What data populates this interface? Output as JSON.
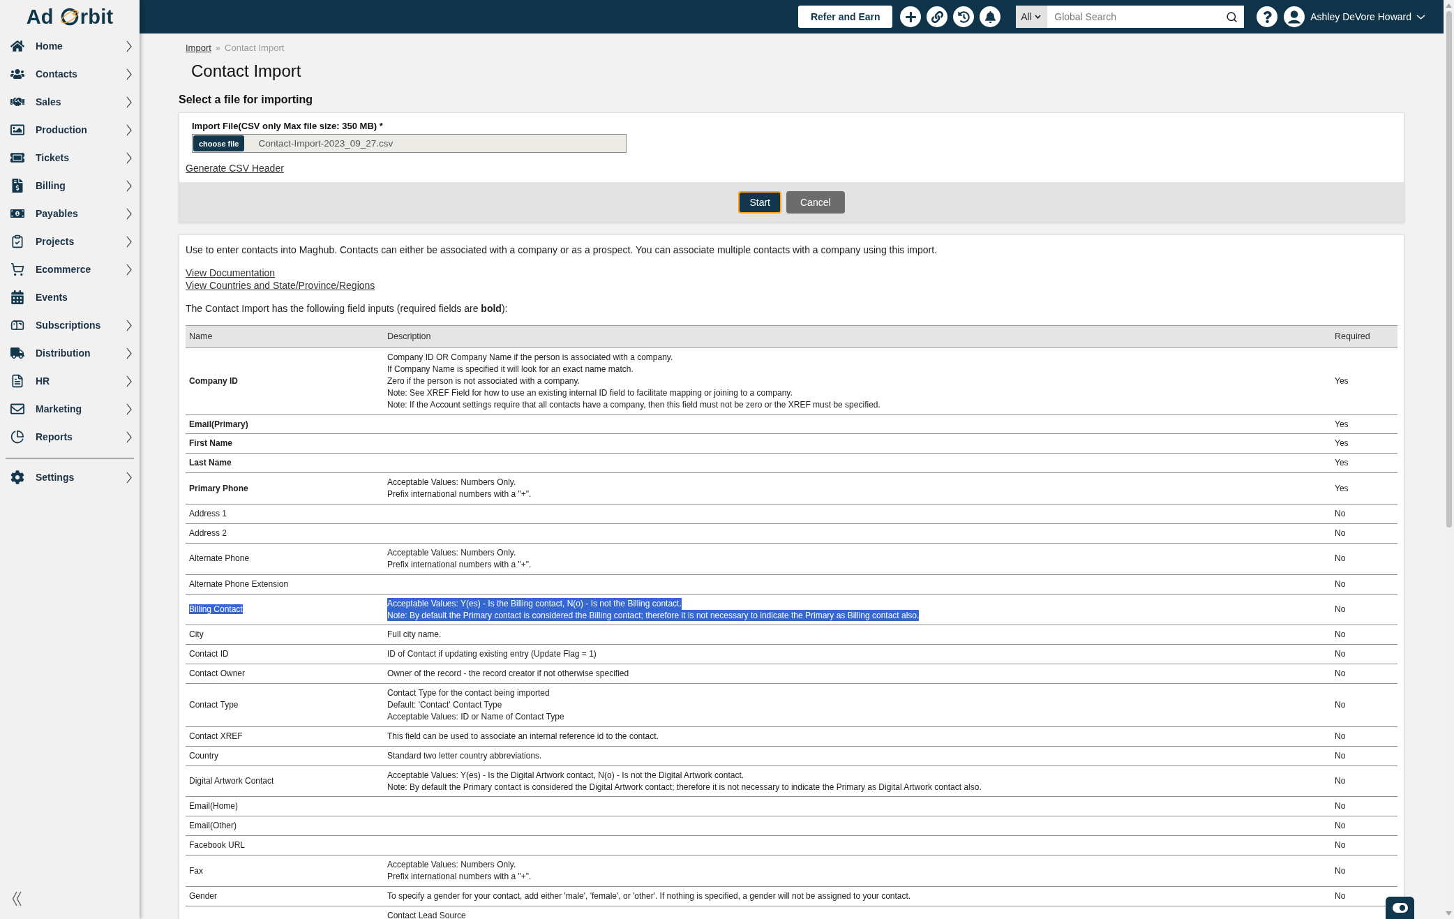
{
  "sidebar": {
    "logo": {
      "left": "Ad",
      "right": "rbit"
    },
    "items": [
      {
        "label": "Home",
        "has_submenu": true
      },
      {
        "label": "Contacts",
        "has_submenu": true
      },
      {
        "label": "Sales",
        "has_submenu": true
      },
      {
        "label": "Production",
        "has_submenu": true
      },
      {
        "label": "Tickets",
        "has_submenu": true
      },
      {
        "label": "Billing",
        "has_submenu": true
      },
      {
        "label": "Payables",
        "has_submenu": true
      },
      {
        "label": "Projects",
        "has_submenu": true
      },
      {
        "label": "Ecommerce",
        "has_submenu": true
      },
      {
        "label": "Events",
        "has_submenu": false
      },
      {
        "label": "Subscriptions",
        "has_submenu": true
      },
      {
        "label": "Distribution",
        "has_submenu": true
      },
      {
        "label": "HR",
        "has_submenu": true
      },
      {
        "label": "Marketing",
        "has_submenu": true
      },
      {
        "label": "Reports",
        "has_submenu": true
      }
    ],
    "bottom_items": [
      {
        "label": "Settings",
        "has_submenu": true
      }
    ]
  },
  "top_bar": {
    "refer_button": "Refer and Earn",
    "search": {
      "scope": "All",
      "placeholder": "Global Search"
    },
    "user_name": "Ashley DeVore Howard"
  },
  "breadcrumb": {
    "separator": "»",
    "items": [
      {
        "label": "Import",
        "link": true
      },
      {
        "label": "Contact Import",
        "link": false
      }
    ]
  },
  "title": "Contact Import",
  "upload": {
    "heading": "Select a file for importing",
    "field_label": "Import File(CSV only Max file size: 350 MB) *",
    "choose_button": "choose file",
    "file_name": "Contact-Import-2023_09_27.csv",
    "header_link": "Generate CSV Header",
    "buttons": [
      {
        "label": "Start",
        "kind": "primary",
        "focused": true
      },
      {
        "label": "Cancel",
        "kind": "secondary",
        "focused": false
      }
    ]
  },
  "info": {
    "intro": "Use to enter contacts into Maghub. Contacts can either be associated with a company or as a prospect. You can associate multiple contacts with a company using this import.",
    "links": [
      "View Documentation",
      "View Countries and State/Province/Regions"
    ],
    "note": "The Contact Import has the following field inputs (required fields are **bold**):"
  },
  "table": {
    "columns": [
      "Name",
      "Description",
      "Required"
    ],
    "rows": [
      {
        "name": "Company ID",
        "bold": true,
        "highlighted": false,
        "description": [
          "Company ID OR Company Name if the person is associated with a company.",
          "If Company Name is specified it will look for an exact name match.",
          "Zero if the person is not associated with a company.",
          "Note: See XREF Field for how to use an existing internal ID field to facilitate mapping or joining to a company.",
          "Note: If the Account settings require that all contacts have a company, then this field must not be zero or the XREF must be specified."
        ],
        "required": "Yes"
      },
      {
        "name": "Email(Primary)",
        "bold": true,
        "highlighted": false,
        "description": [],
        "required": "Yes"
      },
      {
        "name": "First Name",
        "bold": true,
        "highlighted": false,
        "description": [],
        "required": "Yes"
      },
      {
        "name": "Last Name",
        "bold": true,
        "highlighted": false,
        "description": [],
        "required": "Yes"
      },
      {
        "name": "Primary Phone",
        "bold": true,
        "highlighted": false,
        "description": [
          "Acceptable Values: Numbers Only.",
          "Prefix international numbers with a \"+\"."
        ],
        "required": "Yes"
      },
      {
        "name": "Address 1",
        "bold": false,
        "highlighted": false,
        "description": [],
        "required": "No"
      },
      {
        "name": "Address 2",
        "bold": false,
        "highlighted": false,
        "description": [],
        "required": "No"
      },
      {
        "name": "Alternate Phone",
        "bold": false,
        "highlighted": false,
        "description": [
          "Acceptable Values: Numbers Only.",
          "Prefix international numbers with a \"+\"."
        ],
        "required": "No"
      },
      {
        "name": "Alternate Phone Extension",
        "bold": false,
        "highlighted": false,
        "description": [],
        "required": "No"
      },
      {
        "name": "Billing Contact",
        "bold": false,
        "highlighted": true,
        "description": [
          "Acceptable Values: Y(es) - Is the Billing contact, N(o) - Is not the Billing contact.",
          "Note: By default the Primary contact is considered the Billing contact; therefore it is not necessary to indicate the Primary as Billing contact also."
        ],
        "required": "No"
      },
      {
        "name": "City",
        "bold": false,
        "highlighted": false,
        "description": [
          "Full city name."
        ],
        "required": "No"
      },
      {
        "name": "Contact ID",
        "bold": false,
        "highlighted": false,
        "description": [
          "ID of Contact if updating existing entry (Update Flag = 1)"
        ],
        "required": "No"
      },
      {
        "name": "Contact Owner",
        "bold": false,
        "highlighted": false,
        "description": [
          "Owner of the record - the record creator if not otherwise specified"
        ],
        "required": "No"
      },
      {
        "name": "Contact Type",
        "bold": false,
        "highlighted": false,
        "description": [
          "Contact Type for the contact being imported",
          "Default: 'Contact' Contact Type",
          "Acceptable Values: ID or Name of Contact Type"
        ],
        "required": "No"
      },
      {
        "name": "Contact XREF",
        "bold": false,
        "highlighted": false,
        "description": [
          "This field can be used to associate an internal reference id to the contact."
        ],
        "required": "No"
      },
      {
        "name": "Country",
        "bold": false,
        "highlighted": false,
        "description": [
          "Standard two letter country abbreviations."
        ],
        "required": "No"
      },
      {
        "name": "Digital Artwork Contact",
        "bold": false,
        "highlighted": false,
        "description": [
          "Acceptable Values: Y(es) - Is the Digital Artwork contact, N(o) - Is not the Digital Artwork contact.",
          "Note: By default the Primary contact is considered the Digital Artwork contact; therefore it is not necessary to indicate the Primary as Digital Artwork contact also."
        ],
        "required": "No"
      },
      {
        "name": "Email(Home)",
        "bold": false,
        "highlighted": false,
        "description": [],
        "required": "No"
      },
      {
        "name": "Email(Other)",
        "bold": false,
        "highlighted": false,
        "description": [],
        "required": "No"
      },
      {
        "name": "Facebook URL",
        "bold": false,
        "highlighted": false,
        "description": [],
        "required": "No"
      },
      {
        "name": "Fax",
        "bold": false,
        "highlighted": false,
        "description": [
          "Acceptable Values: Numbers Only.",
          "Prefix international numbers with a \"+\"."
        ],
        "required": "No"
      },
      {
        "name": "Gender",
        "bold": false,
        "highlighted": false,
        "description": [
          "To specify a gender for your contact, add either 'male', 'female', or 'other'. If nothing is specified, a gender will not be assigned to your contact."
        ],
        "required": "No"
      },
      {
        "highlighted": false,
        "description": [
          "Contact Lead Source"
        ]
      }
    ]
  }
}
